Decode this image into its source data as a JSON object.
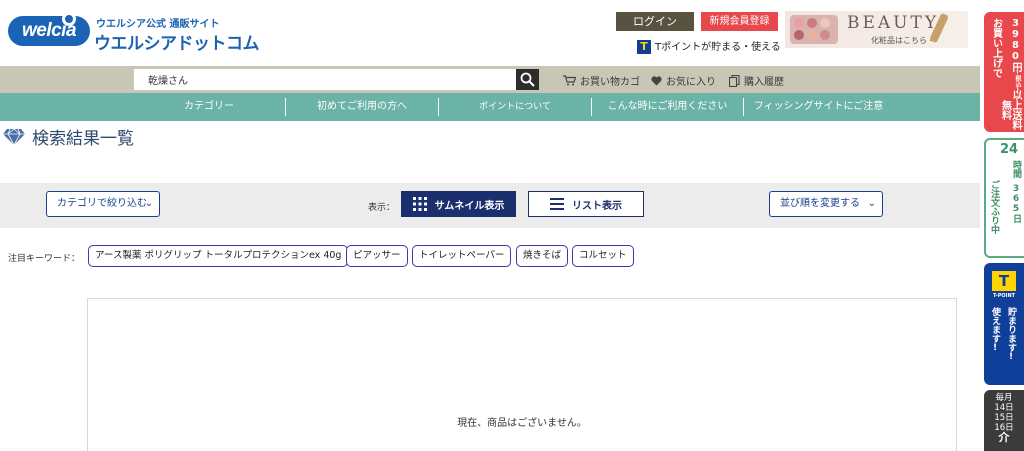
{
  "header": {
    "logo_badge": "welcia",
    "logo_sub": "ウエルシア公式 通販サイト",
    "logo_main": "ウエルシアドットコム",
    "login_label": "ログイン",
    "register_label": "新規会員登録",
    "tpoint_text": "Tポイントが貯まる・使える",
    "tpoint_badge": "T",
    "beauty_title": "BEAUTY",
    "beauty_sub": "化粧品はこちら →"
  },
  "search": {
    "value": "乾燥さん",
    "cart_label": "お買い物カゴ",
    "favorites_label": "お気に入り",
    "history_label": "購入履歴"
  },
  "nav": {
    "items": [
      "カテゴリー",
      "初めてご利用の方へ",
      "ポイントについて",
      "こんな時にご利用ください",
      "フィッシングサイトにご注意"
    ]
  },
  "page": {
    "title": "検索結果一覧"
  },
  "filters": {
    "category_select": "カテゴリで絞り込む",
    "view_label": "表示：",
    "thumbnail_label": "サムネイル表示",
    "list_label": "リスト表示",
    "sort_select": "並び順を変更する"
  },
  "keywords": {
    "label": "注目キーワード：",
    "items": [
      "アース製薬 ポリグリップ トータルプロテクションex 40g",
      "ピアッサー",
      "トイレットペーパー",
      "焼きそば",
      "コルセット"
    ]
  },
  "results": {
    "empty_message": "現在、商品はございません。"
  },
  "sidebar": {
    "free_shipping_col1": "お買い上げで",
    "free_shipping_amount": "3980円",
    "free_shipping_tax": "(税込)",
    "free_shipping_col2": "以上送料無料",
    "hours_big": "24",
    "hours_col1": "時間",
    "hours_col2": "ご注文ふり中",
    "hours_col3": "365日",
    "tpoint_badge": "T",
    "tpoint_caption": "T-POINT",
    "tpoint_col1": "使えます!",
    "tpoint_col2": "貯まります!",
    "days_line1": "毎月",
    "days_line2": "14日",
    "days_line3": "15日",
    "days_line4": "16日",
    "days_line5": "介"
  },
  "colors": {
    "brand_blue": "#1b63b4",
    "nav_teal": "#6bb3a6",
    "search_band": "#cac6b5",
    "register_red": "#e8474b",
    "navy": "#1b2e6e"
  }
}
